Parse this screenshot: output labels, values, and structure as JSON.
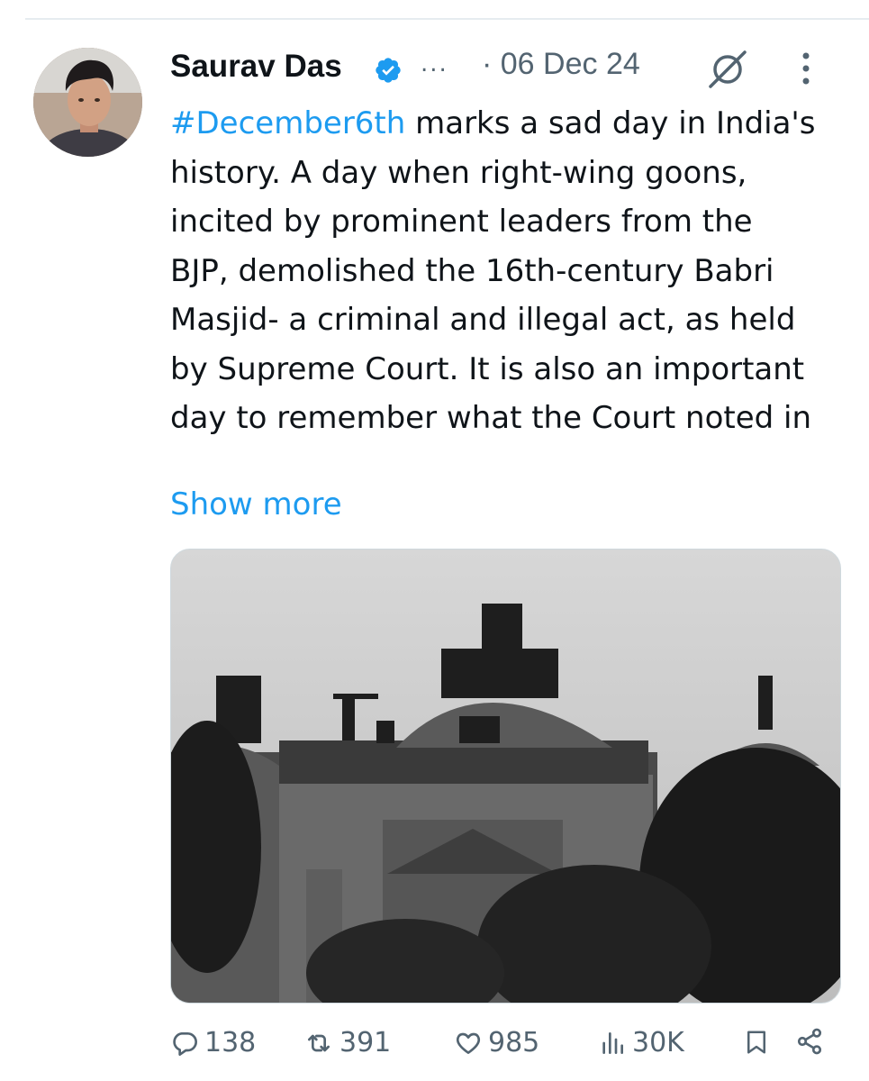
{
  "tweet": {
    "author_name": "Saurav Das",
    "more_dots": "...",
    "date": "· 06 Dec 24",
    "hashtag": "#December6th",
    "body": " marks a sad day in India's history. A day when right-wing goons, incited by prominent leaders from the BJP, demolished the 16th-century Babri Masjid- a criminal and illegal act, as held by Supreme Court. It is also an important day to remember what the Court noted in",
    "show_more": "Show more"
  },
  "metrics": {
    "replies": "138",
    "reposts": "391",
    "likes": "985",
    "views": "30K"
  },
  "colors": {
    "link": "#1d9bf0",
    "muted": "#536471",
    "text": "#0f1419"
  },
  "icons": [
    "verified-badge-icon",
    "grok-icon",
    "more-options-icon",
    "reply-icon",
    "repost-icon",
    "like-icon",
    "views-icon",
    "bookmark-icon",
    "share-icon"
  ]
}
